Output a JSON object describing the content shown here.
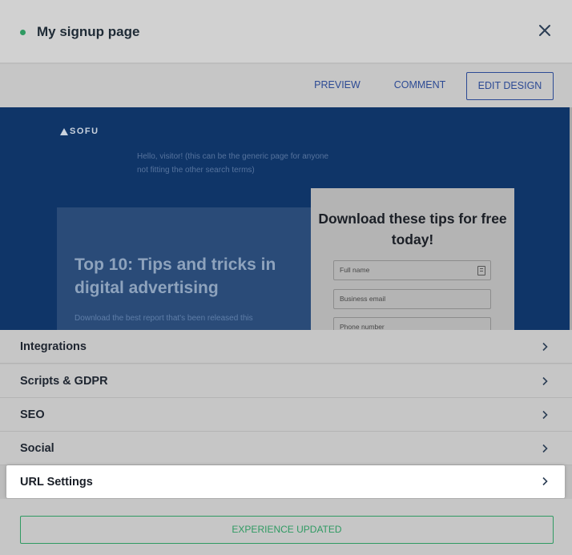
{
  "header": {
    "title": "My signup page",
    "status_color": "#2f9a62",
    "close_icon": "close-icon"
  },
  "toolbar": {
    "preview_label": "PREVIEW",
    "comment_label": "COMMENT",
    "edit_design_label": "EDIT DESIGN"
  },
  "preview": {
    "logo_text": "SOFU",
    "greeting": "Hello, visitor! (this can be the generic page for anyone not fitting the other search terms)",
    "hero_title": "Top 10: Tips and tricks in digital advertising",
    "hero_description": "Download the best report that's been released this",
    "form_title": "Download these tips for free today!",
    "fields": [
      {
        "placeholder": "Full name"
      },
      {
        "placeholder": "Business email"
      },
      {
        "placeholder": "Phone number"
      }
    ]
  },
  "settings": {
    "items": [
      {
        "label": "Integrations"
      },
      {
        "label": "Scripts & GDPR"
      },
      {
        "label": "SEO"
      },
      {
        "label": "Social"
      },
      {
        "label": "URL Settings"
      }
    ]
  },
  "footer": {
    "status_text": "EXPERIENCE UPDATED",
    "status_color": "#2f9a62"
  }
}
